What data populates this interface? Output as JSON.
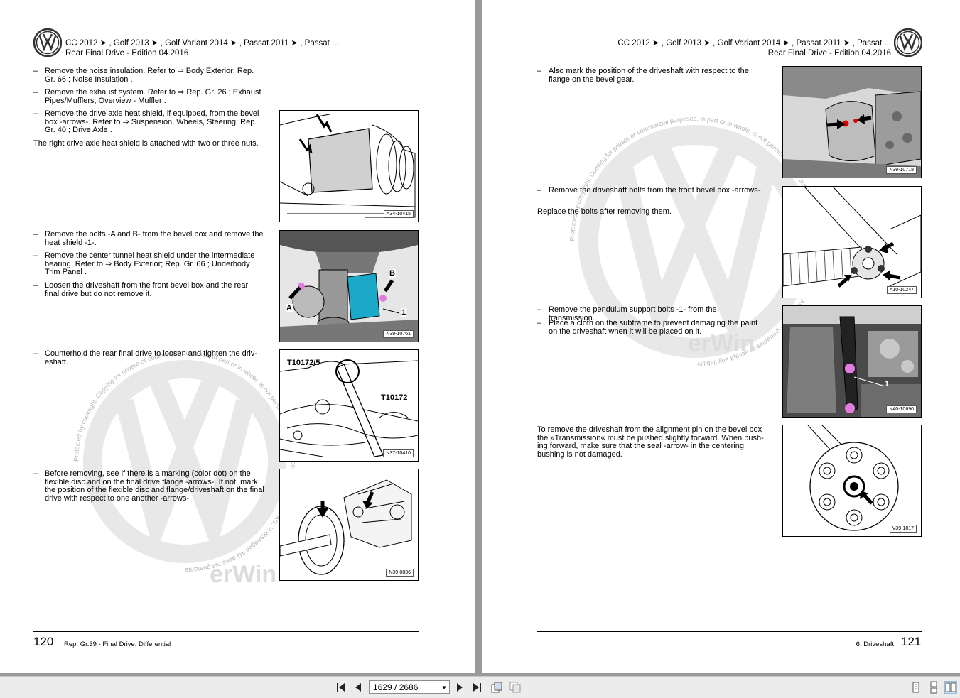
{
  "left_page": {
    "header": {
      "models": "CC 2012 ➤ , Golf 2013 ➤ , Golf Variant 2014 ➤ , Passat 2011 ➤ , Passat ...",
      "subtitle": "Rear Final Drive - Edition 04.2016"
    },
    "steps": [
      "Remove the noise insulation. Refer to ⇒ Body Exterior; Rep. Gr. 66 ; Noise Insulation .",
      "Remove the exhaust system. Refer to ⇒ Rep. Gr. 26 ; Exhaust Pipes/Mufflers; Overview - Muffler .",
      "Remove the drive axle heat shield, if equipped, from the bevel box -arrows-. Refer to ⇒ Suspension, Wheels, Steering; Rep. Gr. 40 ; Drive Axle .",
      "Remove the bolts -A and B- from the bevel box and remove the heat shield -1-.",
      "Remove the center tunnel heat shield under the intermediate bearing. Refer to ⇒ Body Exterior; Rep. Gr. 66 ; Underbody Trim Panel .",
      "Loosen the driveshaft from the front bevel box and the rear final drive but do not remove it.",
      "Counterhold the rear final drive to loosen and tighten the driv-eshaft.",
      "Before removing, see if there is a marking (color dot) on the flexible disc and on the final drive flange -arrows-. If not, mark the position of the flexible disc and flange/driveshaft on the final drive with respect to one another -arrows-."
    ],
    "note": "The right drive axle heat shield is attached with two or three nuts.",
    "figures": [
      {
        "code": "A34-10415"
      },
      {
        "code": "N39-10761",
        "labels": [
          "A",
          "B",
          "1"
        ]
      },
      {
        "code": "N37-10410",
        "labels": [
          "T10172/5",
          "T10172"
        ]
      },
      {
        "code": "N39-0836"
      }
    ],
    "footer": {
      "page_number": "120",
      "text": "Rep. Gr.39 - Final Drive, Differential"
    }
  },
  "right_page": {
    "header": {
      "models": "CC 2012 ➤ , Golf 2013 ➤ , Golf Variant 2014 ➤ , Passat 2011 ➤ , Passat ...",
      "subtitle": "Rear Final Drive - Edition 04.2016"
    },
    "steps": [
      "Also mark the position of the driveshaft with respect to the flange on the bevel gear.",
      "Remove the driveshaft bolts from the front bevel box -arrows-.",
      "Remove the pendulum support bolts -1- from the transmission.",
      "Place a cloth on the subframe to prevent damaging the paint on the driveshaft when it will be placed on it."
    ],
    "note1": "Replace the bolts after removing them.",
    "note2": "To remove the driveshaft from the alignment pin on the bevel box the »Transmission« must be pushed slightly forward. When push-ing forward, make sure that the seal -arrow- in the centering bushing is not damaged.",
    "figures": [
      {
        "code": "N39-10718"
      },
      {
        "code": "A10-10247"
      },
      {
        "code": "N40-10690",
        "labels": [
          "1"
        ]
      },
      {
        "code": "V39-1817"
      }
    ],
    "footer": {
      "page_number": "121",
      "text": "6. Driveshaft"
    }
  },
  "watermark": {
    "arc_text": "Protected by copyright. Copying for private or commercial purposes, in part or in whole, is not permitted unless authorised by Volkswagen AG. Volkswagen AG does not guarantee or accept any liability with respect to the correctness of information in this document. Copyright by Volkswagen AG.",
    "brand": "erWin"
  },
  "toolbar": {
    "page_indicator": "1629 / 2686",
    "buttons": [
      "first-page",
      "previous-page",
      "next-page",
      "last-page",
      "rotate-ccw",
      "rotate-cw",
      "single-page",
      "continuous",
      "two-page"
    ]
  },
  "colors": {
    "viewer_bg": "#9a9a9a",
    "arrow": "#000000",
    "marker_pink": "#e07ce0",
    "shield_cyan": "#1aa9c8",
    "dot_red": "#e00000"
  }
}
